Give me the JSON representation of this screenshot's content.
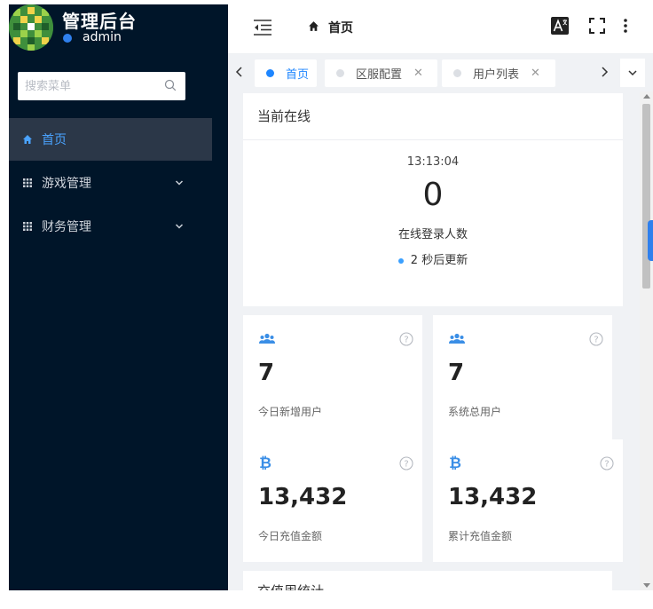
{
  "brand": {
    "title": "管理后台",
    "user": "admin"
  },
  "search": {
    "placeholder": "搜索菜单"
  },
  "menu": [
    {
      "label": "首页",
      "icon": "home-icon",
      "active": true
    },
    {
      "label": "游戏管理",
      "icon": "grid-icon",
      "expandable": true
    },
    {
      "label": "财务管理",
      "icon": "grid-icon",
      "expandable": true
    }
  ],
  "header": {
    "breadcrumb": "首页",
    "buttons": [
      "translate-icon",
      "fullscreen-icon",
      "more-vertical-icon"
    ]
  },
  "tabs": [
    {
      "label": "首页",
      "active": true,
      "closable": false
    },
    {
      "label": "区服配置",
      "active": false,
      "closable": true
    },
    {
      "label": "用户列表",
      "active": false,
      "closable": true
    }
  ],
  "online": {
    "title": "当前在线",
    "time": "13:13:04",
    "count": "0",
    "label": "在线登录人数",
    "refresh": "2 秒后更新"
  },
  "stats": [
    {
      "icon": "users-icon",
      "value": "7",
      "label": "今日新增用户"
    },
    {
      "icon": "users-icon",
      "value": "7",
      "label": "系统总用户"
    },
    {
      "icon": "bitcoin-icon",
      "value": "13,432",
      "label": "今日充值金额"
    },
    {
      "icon": "bitcoin-icon",
      "value": "13,432",
      "label": "累计充值金额"
    }
  ],
  "next_section": {
    "title": "充值周统计"
  },
  "colors": {
    "sidebar": "#001529",
    "accent": "#1e86ff",
    "content_bg": "#f0f2f5"
  }
}
